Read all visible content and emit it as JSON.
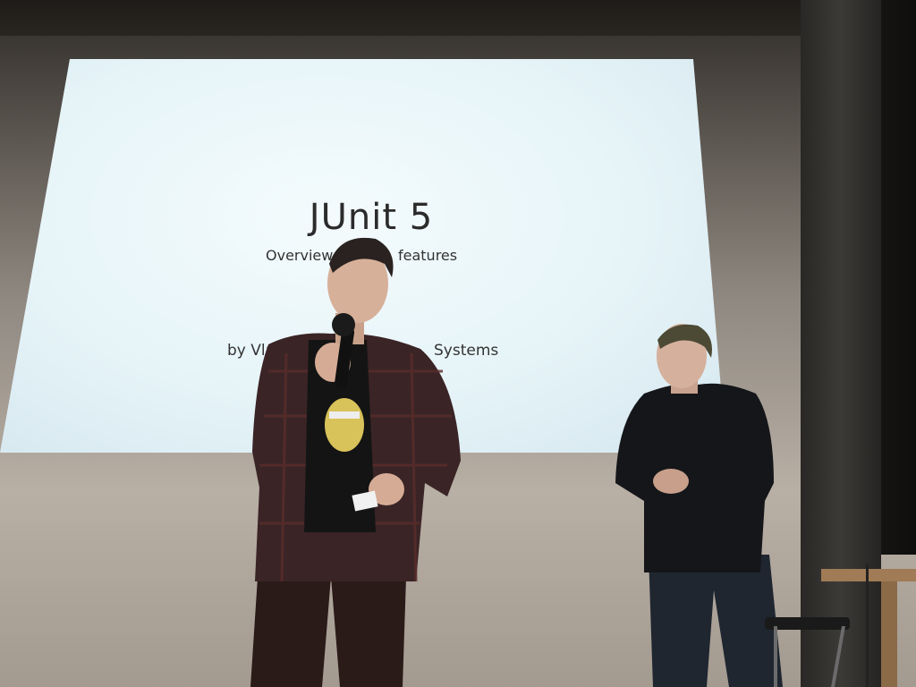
{
  "slide": {
    "title": "JUnit 5",
    "subtitle_left": "Overview",
    "subtitle_right": "features",
    "byline_left": "by Vlad",
    "byline_right": "Systems"
  }
}
